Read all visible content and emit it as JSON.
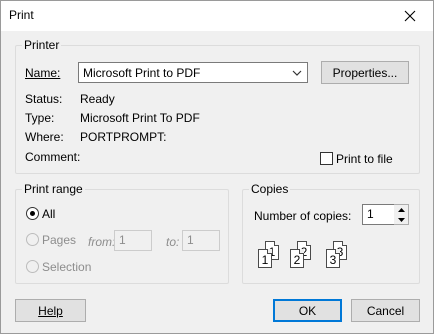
{
  "window": {
    "title": "Print"
  },
  "printer": {
    "group_label": "Printer",
    "name_label": "Name:",
    "name_value": "Microsoft Print to PDF",
    "properties_label": "Properties...",
    "status_label": "Status:",
    "status_value": "Ready",
    "type_label": "Type:",
    "type_value": "Microsoft Print To PDF",
    "where_label": "Where:",
    "where_value": "PORTPROMPT:",
    "comment_label": "Comment:",
    "comment_value": "",
    "print_to_file_label": "Print to file",
    "print_to_file_checked": false
  },
  "print_range": {
    "group_label": "Print range",
    "all_label": "All",
    "pages_label": "Pages",
    "from_label": "from:",
    "from_value": "1",
    "to_label": "to:",
    "to_value": "1",
    "selection_label": "Selection",
    "selected": "all"
  },
  "copies": {
    "group_label": "Copies",
    "number_label": "Number of copies:",
    "number_value": "1",
    "collate_pages": [
      "1",
      "1",
      "2",
      "2",
      "3",
      "3"
    ]
  },
  "buttons": {
    "help_label": "Help",
    "ok_label": "OK",
    "cancel_label": "Cancel"
  }
}
